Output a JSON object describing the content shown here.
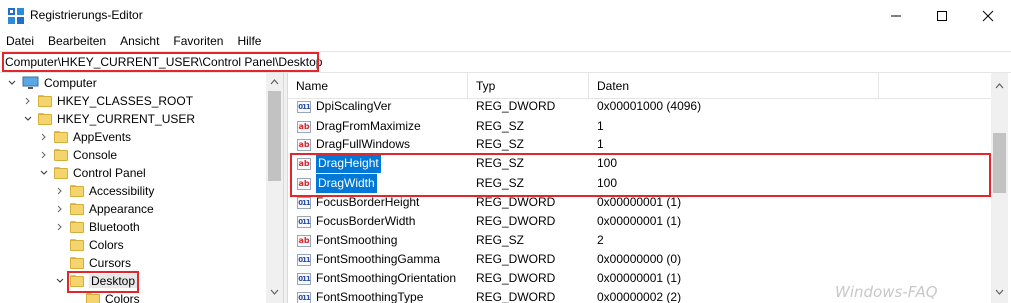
{
  "window": {
    "title": "Registrierungs-Editor",
    "icon": "registry-editor-icon",
    "controls": [
      "minimize-icon",
      "maximize-icon",
      "close-icon"
    ]
  },
  "menu": [
    "Datei",
    "Bearbeiten",
    "Ansicht",
    "Favoriten",
    "Hilfe"
  ],
  "address": "Computer\\HKEY_CURRENT_USER\\Control Panel\\Desktop",
  "tree": [
    {
      "label": "Computer",
      "expanded": true
    },
    {
      "label": "HKEY_CLASSES_ROOT",
      "expanded": false
    },
    {
      "label": "HKEY_CURRENT_USER",
      "expanded": true
    },
    {
      "label": "AppEvents",
      "expanded": false
    },
    {
      "label": "Console",
      "expanded": false
    },
    {
      "label": "Control Panel",
      "expanded": true
    },
    {
      "label": "Accessibility",
      "expanded": false
    },
    {
      "label": "Appearance",
      "expanded": false
    },
    {
      "label": "Bluetooth",
      "expanded": false
    },
    {
      "label": "Colors",
      "expanded": false
    },
    {
      "label": "Cursors",
      "expanded": false
    },
    {
      "label": "Desktop",
      "expanded": true,
      "selected": true
    },
    {
      "label": "Colors",
      "expanded": false
    }
  ],
  "columns": {
    "name": "Name",
    "type": "Typ",
    "data": "Daten"
  },
  "values": [
    {
      "name": "DpiScalingVer",
      "type": "REG_DWORD",
      "data": "0x00001000 (4096)"
    },
    {
      "name": "DragFromMaximize",
      "type": "REG_SZ",
      "data": "1"
    },
    {
      "name": "DragFullWindows",
      "type": "REG_SZ",
      "data": "1"
    },
    {
      "name": "DragHeight",
      "type": "REG_SZ",
      "data": "100",
      "selected": true
    },
    {
      "name": "DragWidth",
      "type": "REG_SZ",
      "data": "100",
      "selected": true
    },
    {
      "name": "FocusBorderHeight",
      "type": "REG_DWORD",
      "data": "0x00000001 (1)"
    },
    {
      "name": "FocusBorderWidth",
      "type": "REG_DWORD",
      "data": "0x00000001 (1)"
    },
    {
      "name": "FontSmoothing",
      "type": "REG_SZ",
      "data": "2"
    },
    {
      "name": "FontSmoothingGamma",
      "type": "REG_DWORD",
      "data": "0x00000000 (0)"
    },
    {
      "name": "FontSmoothingOrientation",
      "type": "REG_DWORD",
      "data": "0x00000001 (1)"
    },
    {
      "name": "FontSmoothingType",
      "type": "REG_DWORD",
      "data": "0x00000002 (2)"
    }
  ],
  "watermark": "Windows-FAQ",
  "colors": {
    "highlight": "#0078d7",
    "annotation": "#e2262b",
    "folder": "#f3d46d"
  }
}
